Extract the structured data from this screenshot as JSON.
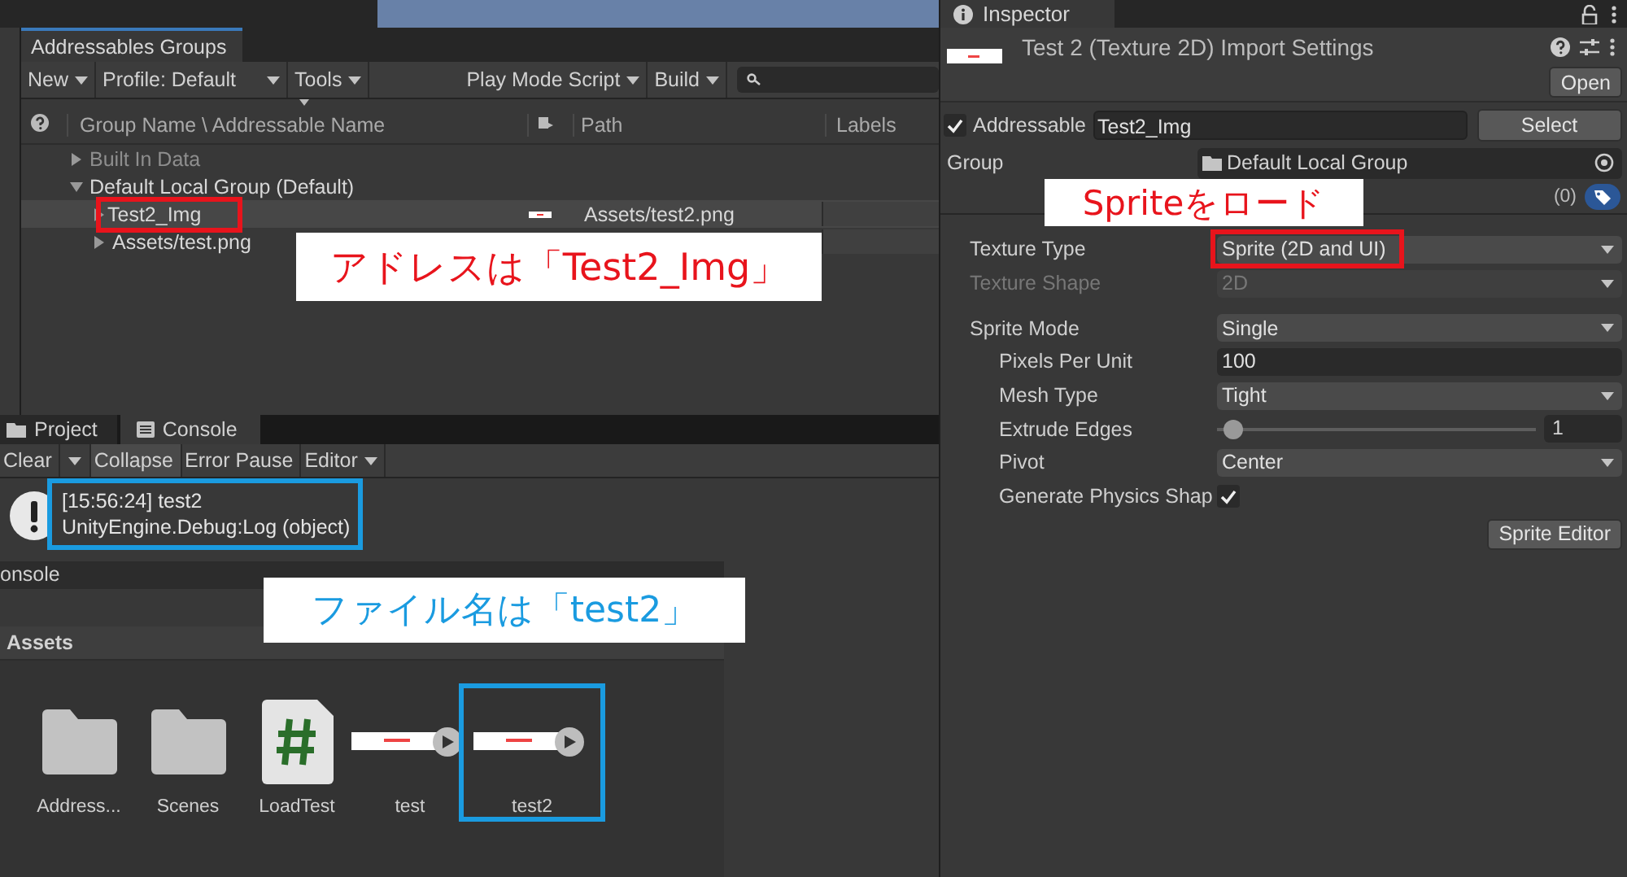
{
  "addressables": {
    "tab": "Addressables Groups",
    "toolbar_left": [
      {
        "label": "Profile: Default",
        "kind": "wide"
      }
    ],
    "toolbar_first": [
      {
        "label": "New",
        "kind": "menu"
      }
    ],
    "toolbar_tools": [
      {
        "label": "Tools",
        "kind": "menu"
      }
    ],
    "toolbar_right": [
      {
        "label": "Play Mode Script",
        "kind": "menu"
      },
      {
        "label": "Build",
        "kind": "menu"
      }
    ],
    "columns": [
      "Group Name \\ Addressable Name",
      "Path",
      "Labels"
    ],
    "tree": [
      {
        "name": "Built In Data",
        "expanded": false,
        "selected": false,
        "disabled": true,
        "framed": false
      },
      {
        "name": "Default Local Group (Default)",
        "expanded": true,
        "selected": false,
        "disabled": false,
        "framed": false,
        "children": [
          {
            "name": "Test2_Img",
            "expanded": false,
            "selected": true,
            "disabled": false,
            "framed": true,
            "path": "Assets/test2.png"
          },
          {
            "name": "Assets/test.png",
            "expanded": false,
            "selected": false,
            "disabled": false,
            "framed": false
          }
        ]
      }
    ],
    "callout": {
      "text": "アドレスは「Test2_Img」",
      "color": "#e8141c"
    }
  },
  "console": {
    "tabs": [
      {
        "label": "Project",
        "selected": false
      },
      {
        "label": "Console",
        "selected": true
      }
    ],
    "toolbar": [
      {
        "label": "Clear",
        "kind": "split",
        "on": false
      },
      {
        "label": "Collapse",
        "kind": "toggle",
        "on": true
      },
      {
        "label": "Error Pause",
        "kind": "toggle",
        "on": false
      },
      {
        "label": "Editor",
        "kind": "menu",
        "on": false
      }
    ],
    "log": [
      {
        "lines": [
          "[15:56:24] test2",
          "UnityEngine.Debug:Log (object)"
        ],
        "framed": true
      }
    ],
    "status": "onsole",
    "callout": {
      "text": "ファイル名は「test2」",
      "color": "#1a9be0"
    }
  },
  "project": {
    "breadcrumb": "Assets",
    "items": [
      {
        "kind": "folder",
        "label": "Address...",
        "framed": false
      },
      {
        "kind": "folder",
        "label": "Scenes",
        "framed": false
      },
      {
        "kind": "script",
        "label": "LoadTest",
        "framed": false
      },
      {
        "kind": "sprite",
        "label": "test",
        "framed": false
      },
      {
        "kind": "sprite",
        "label": "test2",
        "framed": true
      }
    ]
  },
  "inspector": {
    "tab": "Inspector",
    "title": "Test 2 (Texture 2D) Import Settings",
    "open_button": "Open",
    "addressable": {
      "checked": true,
      "label": "Addressable",
      "value": "Test2_Img"
    },
    "select_button": "Select",
    "group": {
      "label": "Group",
      "value": "Default Local Group"
    },
    "labels_count": "(0)",
    "callout": {
      "text": "Spriteをロード",
      "color": "#e8141c"
    },
    "properties": [
      {
        "kind": "dropdown",
        "label": "Texture Type",
        "value": "Sprite (2D and UI)",
        "disabled": false,
        "framed": true
      },
      {
        "kind": "dropdown",
        "label": "Texture Shape",
        "value": "2D",
        "disabled": true,
        "framed": false
      },
      {
        "kind": "dropdown",
        "label": "Sprite Mode",
        "value": "Single",
        "disabled": false,
        "framed": false,
        "children": [
          {
            "kind": "number",
            "label": "Pixels Per Unit",
            "value": "100"
          },
          {
            "kind": "dropdown",
            "label": "Mesh Type",
            "value": "Tight"
          },
          {
            "kind": "slider",
            "label": "Extrude Edges",
            "level": 0.05,
            "value": "1"
          },
          {
            "kind": "dropdown",
            "label": "Pivot",
            "value": "Center"
          },
          {
            "kind": "checkbox",
            "label": "Generate Physics Shap",
            "checked": true
          }
        ]
      }
    ],
    "sprite_editor_button": "Sprite Editor"
  }
}
